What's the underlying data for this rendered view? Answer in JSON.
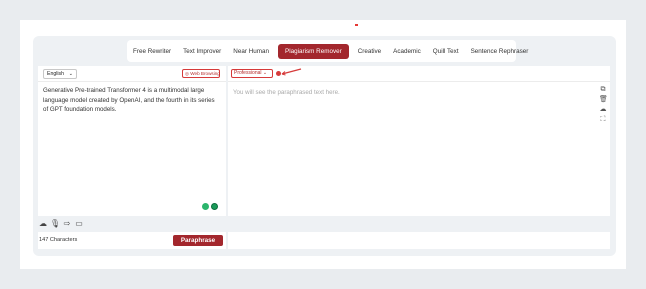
{
  "tabs": [
    {
      "label": "Free Rewriter",
      "active": false
    },
    {
      "label": "Text Improver",
      "active": false
    },
    {
      "label": "Near Human",
      "active": false
    },
    {
      "label": "Plagiarism Remover",
      "active": true
    },
    {
      "label": "Creative",
      "active": false
    },
    {
      "label": "Academic",
      "active": false
    },
    {
      "label": "Quill Text",
      "active": false
    },
    {
      "label": "Sentence Rephraser",
      "active": false
    }
  ],
  "left": {
    "language": "English",
    "web_browsing_label": "Web Browsing",
    "input_text": "Generative Pre-trained Transformer 4 is a multimodal large language model created by OpenAI, and the fourth in its series of GPT foundation models."
  },
  "right": {
    "mode": "Professional",
    "placeholder": "You will see the paraphrased text here."
  },
  "footer": {
    "char_count": "147 Characters",
    "paraphrase_label": "Paraphrase"
  },
  "icons": {
    "tools": [
      "upload-icon",
      "mic-icon",
      "share-icon",
      "image-icon"
    ],
    "side": [
      "copy-icon",
      "delete-icon",
      "download-icon",
      "expand-icon"
    ]
  },
  "colors": {
    "accent": "#a3272d",
    "panel_bg": "#eef1f4",
    "page_bg": "#e9ecef"
  }
}
